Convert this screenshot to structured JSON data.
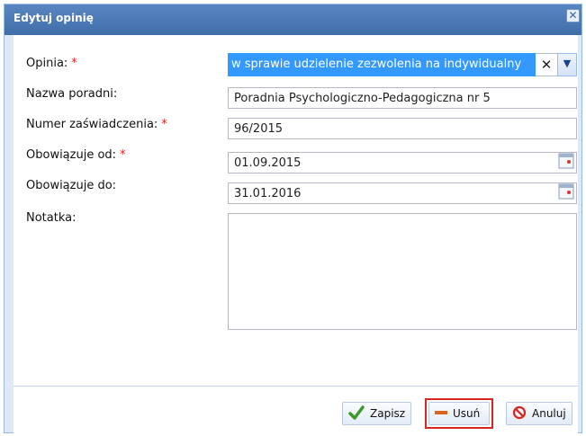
{
  "dialog": {
    "title": "Edytuj opinię",
    "close_glyph": "✕"
  },
  "form": {
    "opinia": {
      "label": "Opinia:",
      "required": "*",
      "value": "w sprawie udzielenie zezwolenia na indywidualny",
      "clear_glyph": "✕",
      "trigger_glyph": "▼"
    },
    "nazwa_poradni": {
      "label": "Nazwa poradni:",
      "value": "Poradnia Psychologiczno-Pedagogiczna nr 5"
    },
    "numer_zaswiadczenia": {
      "label": "Numer zaświadczenia:",
      "required": "*",
      "value": "96/2015"
    },
    "obowiazuje_od": {
      "label": "Obowiązuje od:",
      "required": "*",
      "value": "01.09.2015"
    },
    "obowiazuje_do": {
      "label": "Obowiązuje do:",
      "value": "31.01.2016"
    },
    "notatka": {
      "label": "Notatka:",
      "value": ""
    }
  },
  "buttons": {
    "zapisz": "Zapisz",
    "usun": "Usuń",
    "anuluj": "Anuluj"
  },
  "colors": {
    "title_bar": "#4a78b5",
    "selection": "#3399ff",
    "required": "#e02020",
    "highlight_border": "#d9251d"
  },
  "icons": {
    "zapisz": "checkmark-icon",
    "usun": "minus-icon",
    "anuluj": "cancel-icon",
    "date": "calendar-icon"
  }
}
